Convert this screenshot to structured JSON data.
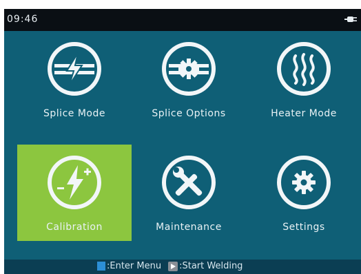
{
  "status_bar": {
    "time": "09:46"
  },
  "menu": {
    "items": [
      {
        "label": "Splice Mode",
        "icon": "splice-mode-icon",
        "selected": false
      },
      {
        "label": "Splice Options",
        "icon": "splice-options-icon",
        "selected": false
      },
      {
        "label": "Heater Mode",
        "icon": "heater-mode-icon",
        "selected": false
      },
      {
        "label": "Calibration",
        "icon": "calibration-icon",
        "selected": true
      },
      {
        "label": "Maintenance",
        "icon": "maintenance-icon",
        "selected": false
      },
      {
        "label": "Settings",
        "icon": "settings-icon",
        "selected": false
      }
    ]
  },
  "footer": {
    "enter_hint": ":Enter Menu",
    "start_hint": ":Start Welding"
  },
  "colors": {
    "screen_bg": "#0f5f76",
    "topbar_bg": "#0a0f14",
    "selected_bg": "#8cc63f",
    "footer_bg": "#0b3e53",
    "menu_key": "#2c8fd6"
  }
}
